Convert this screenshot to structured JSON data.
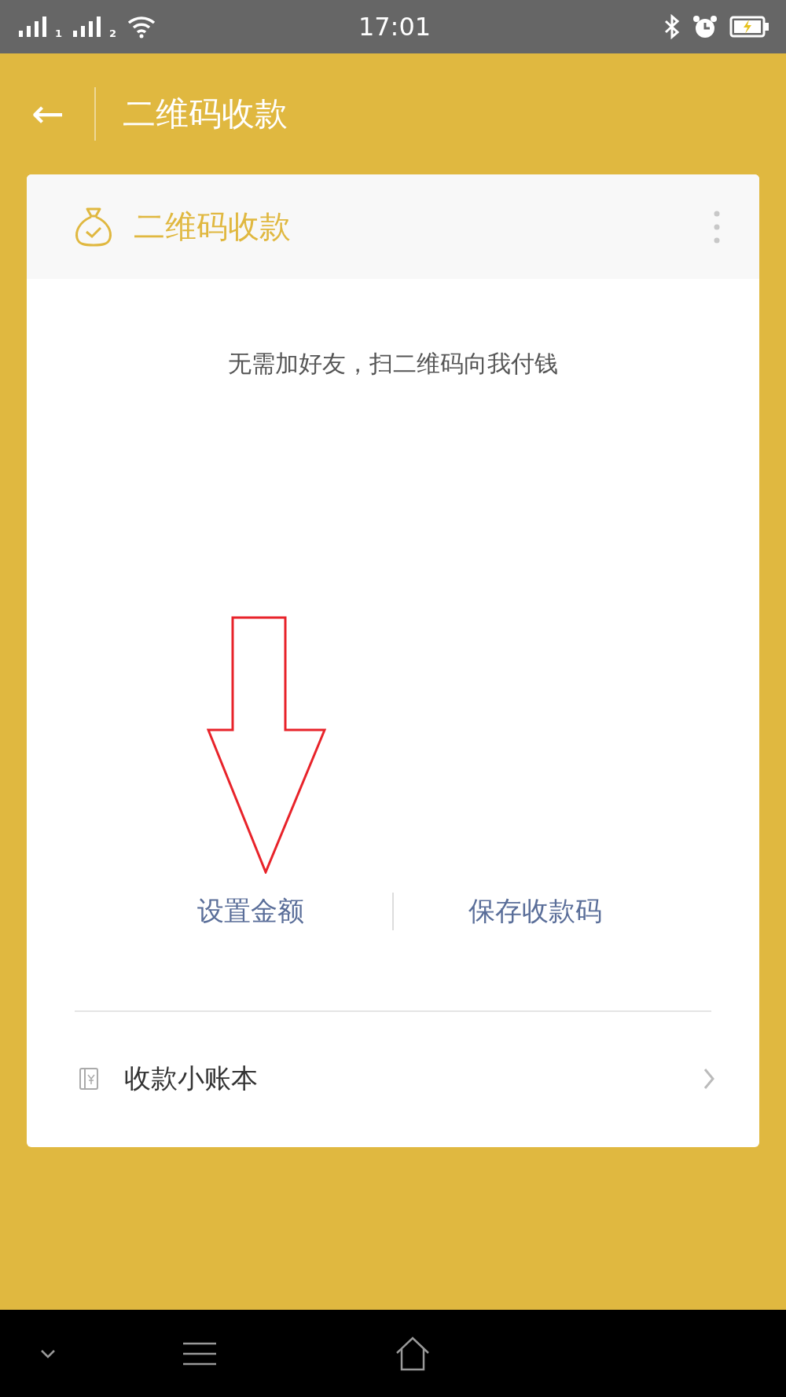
{
  "status_bar": {
    "sim_labels": [
      "1",
      "2"
    ],
    "time": "17:01"
  },
  "header": {
    "back": "←",
    "title": "二维码收款"
  },
  "card": {
    "title": "二维码收款",
    "subtitle": "无需加好友，扫二维码向我付钱",
    "actions": [
      {
        "label": "设置金额"
      },
      {
        "label": "保存收款码"
      }
    ],
    "row": {
      "label": "收款小账本"
    }
  }
}
